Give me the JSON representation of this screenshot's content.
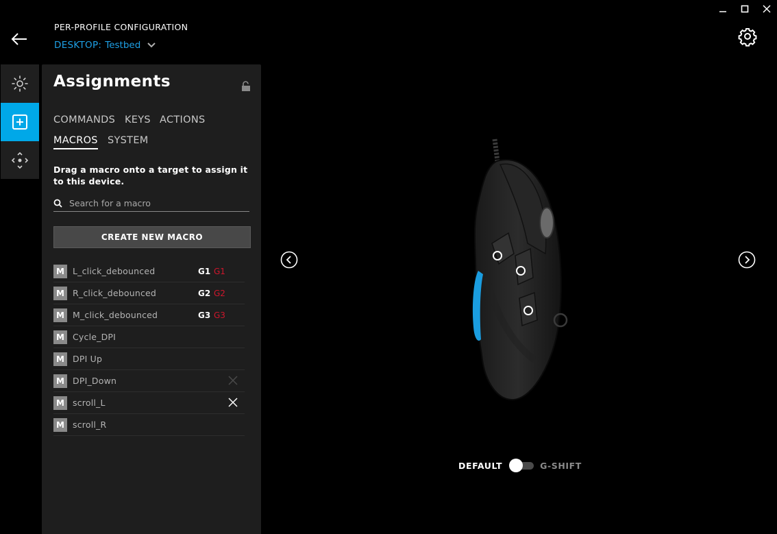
{
  "window": {
    "controls": [
      "minimize-icon",
      "maximize-icon",
      "close-icon"
    ]
  },
  "header": {
    "title": "PER-PROFILE CONFIGURATION",
    "profile_prefix": "DESKTOP:",
    "profile_name": "Testbed"
  },
  "rail": {
    "items": [
      {
        "icon": "lighting-icon",
        "active": false
      },
      {
        "icon": "assignments-icon",
        "active": true
      },
      {
        "icon": "sensitivity-icon",
        "active": false
      }
    ]
  },
  "panel": {
    "title": "Assignments",
    "tabs_row1": [
      "COMMANDS",
      "KEYS",
      "ACTIONS"
    ],
    "tabs_row2": [
      "MACROS",
      "SYSTEM"
    ],
    "active_tab": "MACROS",
    "hint": "Drag a macro onto a target to assign it to this device.",
    "search_placeholder": "Search for a macro",
    "create_button": "CREATE NEW MACRO",
    "macro_badge": "M",
    "macros": [
      {
        "name": "L_click_debounced",
        "key": "G1",
        "shift": "G1",
        "remove": false
      },
      {
        "name": "R_click_debounced",
        "key": "G2",
        "shift": "G2",
        "remove": false
      },
      {
        "name": "M_click_debounced",
        "key": "G3",
        "shift": "G3",
        "remove": false
      },
      {
        "name": "Cycle_DPI",
        "key": "",
        "shift": "",
        "remove": false
      },
      {
        "name": "DPI Up",
        "key": "",
        "shift": "",
        "remove": false
      },
      {
        "name": "DPI_Down",
        "key": "",
        "shift": "",
        "remove": "faint"
      },
      {
        "name": "scroll_L",
        "key": "",
        "shift": "",
        "remove": true
      },
      {
        "name": "scroll_R",
        "key": "",
        "shift": "",
        "remove": false
      }
    ]
  },
  "stage": {
    "toggle_left": "DEFAULT",
    "toggle_right": "G-SHIFT",
    "toggle_state": "DEFAULT"
  },
  "colors": {
    "accent": "#1ea0e6",
    "gshift_red": "#d0162c",
    "panel_bg": "#1e1e1e"
  }
}
